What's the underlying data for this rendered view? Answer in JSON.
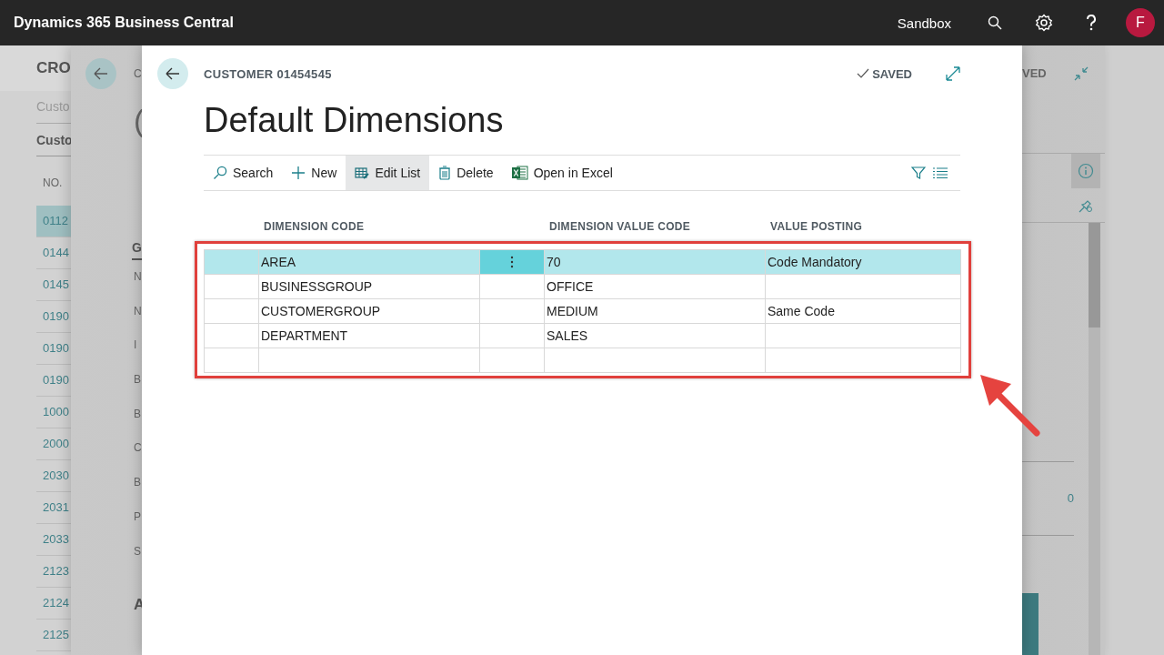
{
  "top_bar": {
    "app_name": "Dynamics 365 Business Central",
    "environment": "Sandbox",
    "avatar_initial": "F"
  },
  "back_page": {
    "title": "CRO",
    "subtitle": "Custo",
    "section": "Custo",
    "column": "NO.",
    "rows": [
      {
        "no": "0112",
        "selected": true
      },
      {
        "no": "0144",
        "selected": false
      },
      {
        "no": "0145",
        "selected": false
      },
      {
        "no": "0190",
        "selected": false
      },
      {
        "no": "0190",
        "selected": false
      },
      {
        "no": "0190",
        "selected": false
      },
      {
        "no": "1000",
        "selected": false
      },
      {
        "no": "2000",
        "selected": false
      },
      {
        "no": "2030",
        "selected": false
      },
      {
        "no": "2031",
        "selected": false
      },
      {
        "no": "2033",
        "selected": false
      },
      {
        "no": "2123",
        "selected": false
      },
      {
        "no": "2124",
        "selected": false
      },
      {
        "no": "2125",
        "selected": false
      }
    ]
  },
  "middle_page": {
    "breadcrumb": "C",
    "title": "(",
    "section": "G",
    "field_labels": [
      "N",
      "N",
      "I",
      "B",
      "B",
      "C",
      "B",
      "P",
      "S"
    ],
    "section_2": "A",
    "status": "VED",
    "value": "0"
  },
  "dialog": {
    "breadcrumb": "CUSTOMER 01454545",
    "status": "SAVED",
    "title": "Default Dimensions",
    "actions": [
      {
        "kind": "search",
        "label": "Search",
        "selected": false
      },
      {
        "kind": "new",
        "label": "New",
        "selected": false
      },
      {
        "kind": "edit",
        "label": "Edit List",
        "selected": true
      },
      {
        "kind": "delete",
        "label": "Delete",
        "selected": false
      },
      {
        "kind": "excel",
        "label": "Open in Excel",
        "selected": false
      }
    ],
    "columns": [
      "DIMENSION CODE",
      "DIMENSION VALUE CODE",
      "VALUE POSTING"
    ],
    "rows": [
      {
        "dimension_code": "AREA",
        "dimension_value_code": "70",
        "value_posting": "Code Mandatory",
        "selected": true
      },
      {
        "dimension_code": "BUSINESSGROUP",
        "dimension_value_code": "OFFICE",
        "selected": false
      },
      {
        "dimension_code": "CUSTOMERGROUP",
        "dimension_value_code": "MEDIUM",
        "value_posting": "Same Code",
        "selected": false
      },
      {
        "dimension_code": "DEPARTMENT",
        "dimension_value_code": "SALES",
        "selected": false
      }
    ]
  }
}
